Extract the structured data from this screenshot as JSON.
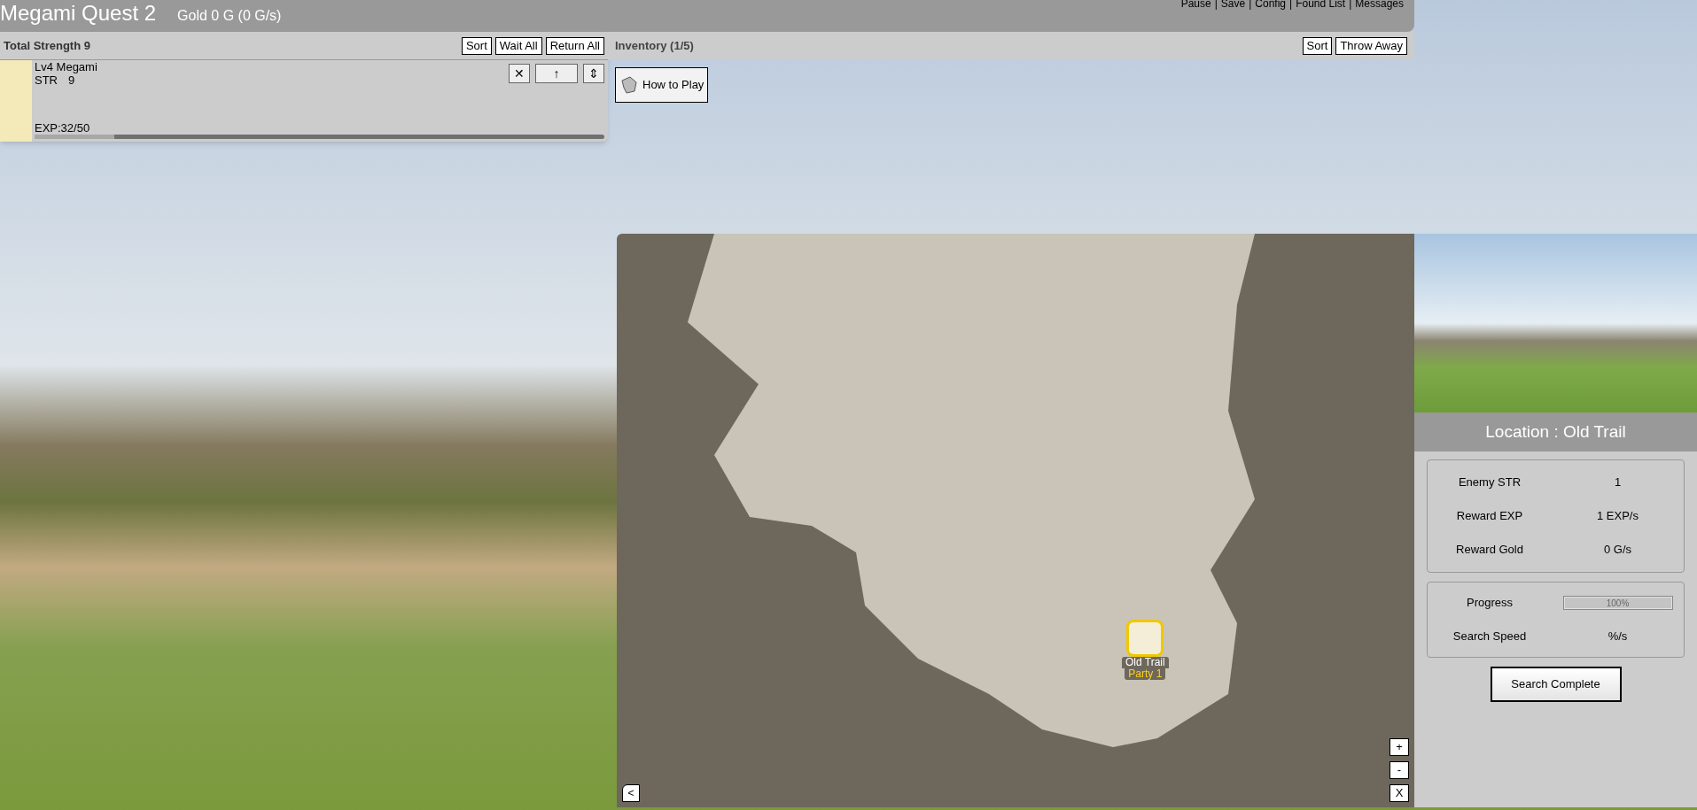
{
  "header": {
    "title": "Megami Quest 2",
    "gold": "Gold 0 G (0 G/s)",
    "menu": [
      "Pause",
      "|",
      "Save",
      "|",
      "Config",
      "|",
      "Found List",
      "|",
      "Messages"
    ]
  },
  "party": {
    "title": "Total Strength 9",
    "buttons": [
      "Sort",
      "Wait All",
      "Return All"
    ],
    "members": [
      {
        "name": "Lv4 Megami",
        "stat_label": "STR",
        "stat_value": "9",
        "exp": "EXP:32/50",
        "level": 0.14,
        "controls": [
          "✕",
          "↑",
          "⇕"
        ]
      }
    ]
  },
  "inventory": {
    "title": "Inventory (1/5)",
    "buttons": [
      "Sort",
      "Throw Away"
    ],
    "items": [
      "How to Play"
    ]
  },
  "map": {
    "markers": [
      {
        "label": "Old Trail",
        "party": "Party 1"
      }
    ],
    "zoom_buttons": [
      "+",
      "-",
      "X"
    ],
    "back_button": "<"
  },
  "location": {
    "title": "Location : Old Trail",
    "stats": [
      {
        "label": "Enemy STR",
        "value": "1"
      },
      {
        "label": "Reward EXP",
        "value": "1 EXP/s"
      },
      {
        "label": "Reward Gold",
        "value": "0 G/s"
      }
    ],
    "progress": {
      "label": "Progress",
      "reading": "100%",
      "level": 1
    },
    "speed": {
      "label": "Search Speed",
      "value": "%/s"
    },
    "button": "Search Complete"
  }
}
